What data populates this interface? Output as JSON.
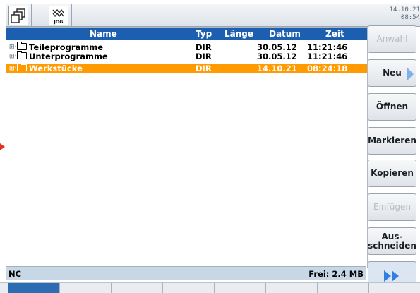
{
  "topbar": {
    "windows_icon": "windows-stack-icon",
    "mode_label": "JOG",
    "mode_icon": "jog-wave-icon",
    "date": "14.10.21",
    "time": "08:54"
  },
  "file_list": {
    "columns": [
      "Name",
      "Typ",
      "Länge",
      "Datum",
      "Zeit"
    ],
    "rows": [
      {
        "name": "Teileprogramme",
        "type": "DIR",
        "length": "",
        "date": "30.05.12",
        "time": "11:21:46",
        "selected": false
      },
      {
        "name": "Unterprogramme",
        "type": "DIR",
        "length": "",
        "date": "30.05.12",
        "time": "11:21:46",
        "selected": false
      },
      {
        "name": "Werkstücke",
        "type": "DIR",
        "length": "",
        "date": "14.10.21",
        "time": "08:24:18",
        "selected": true
      }
    ]
  },
  "status": {
    "left": "NC",
    "right": "Frei: 2.4 MB"
  },
  "softkeys": {
    "anwahl": "Anwahl",
    "neu": "Neu",
    "oeffnen": "Öffnen",
    "markieren": "Markieren",
    "kopieren": "Kopieren",
    "einfuegen": "Einfügen",
    "ausschneiden_1": "Aus-",
    "ausschneiden_2": "schneiden"
  },
  "colors": {
    "header": "#1c5fb0",
    "selection": "#ff9a00",
    "status": "#c8d7e6"
  }
}
